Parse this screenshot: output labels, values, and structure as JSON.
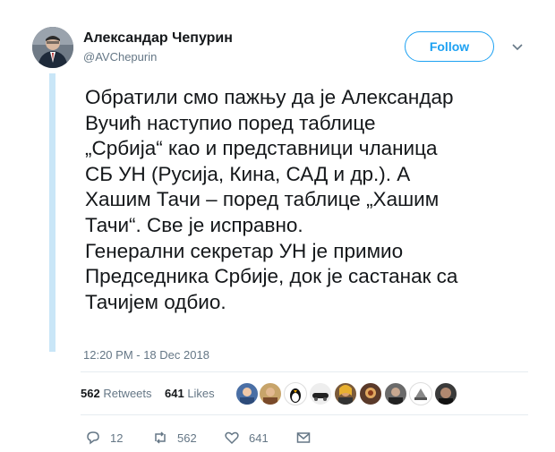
{
  "author": {
    "name": "Александар Чепурин",
    "handle": "@AVChepurin"
  },
  "follow_label": "Follow",
  "tweet_lines": [
    "Обратили смо пажњу да је Александар",
    "Вучић наступио поред таблице",
    "„Србија“ као и представници чланица",
    "СБ УН (Русија, Кина, САД и др.). А",
    "Хашим Тачи – поред таблице „Хашим",
    "Тачи“. Све је исправно.",
    "Генерални секретар УН је примио",
    "Председника Србије, док је састанак са",
    "Тачијем одбио."
  ],
  "timestamp": "12:20 PM - 18 Dec 2018",
  "stats": {
    "retweets_count": "562",
    "retweets_label": "Retweets",
    "likes_count": "641",
    "likes_label": "Likes"
  },
  "actions": {
    "replies": "12",
    "retweets": "562",
    "likes": "641"
  },
  "icons": {
    "caret": "chevron-down-icon",
    "reply": "reply-icon",
    "retweet": "retweet-icon",
    "like": "heart-icon",
    "dm": "envelope-icon"
  },
  "colors": {
    "accent": "#1da1f2",
    "muted": "#657786",
    "thread_bar": "#c9e6f7"
  }
}
